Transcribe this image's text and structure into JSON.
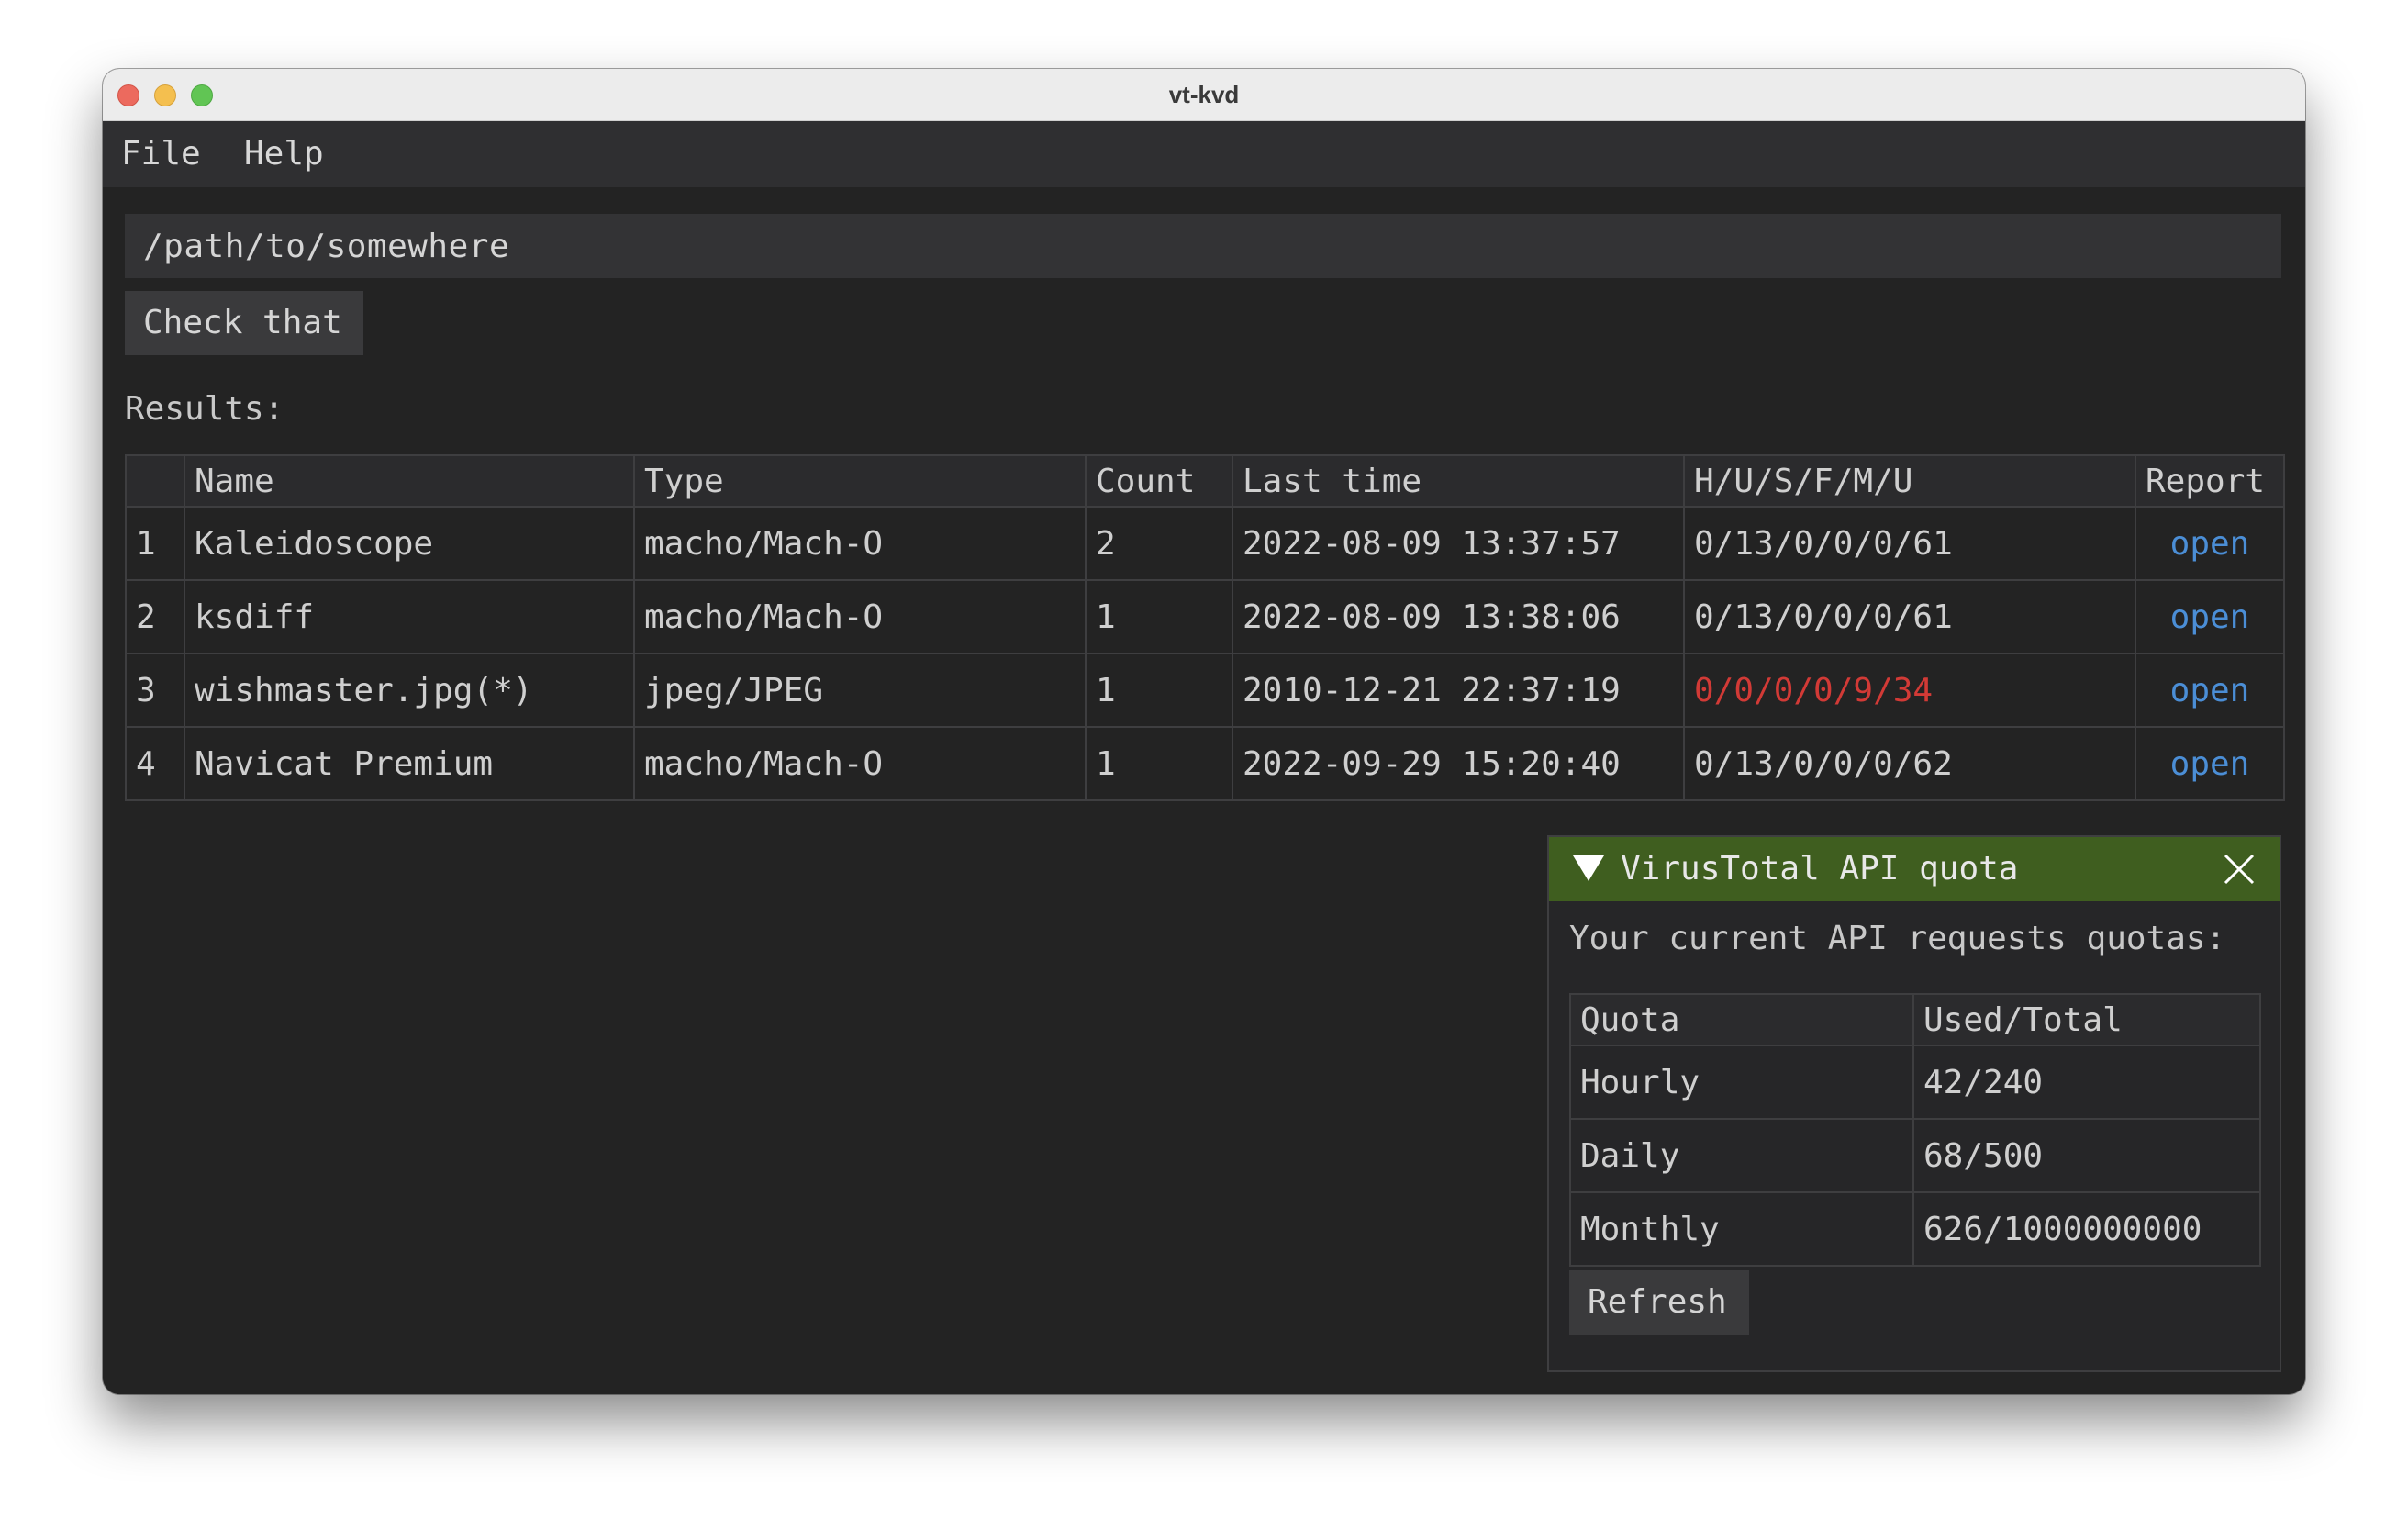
{
  "window": {
    "title": "vt-kvd"
  },
  "menu": {
    "file": "File",
    "help": "Help"
  },
  "path_input": {
    "value": "/path/to/somewhere"
  },
  "check_button": {
    "label": "Check that"
  },
  "results": {
    "label": "Results:",
    "columns": [
      "",
      "Name",
      "Type",
      "Count",
      "Last time",
      "H/U/S/F/M/U",
      "Report"
    ],
    "rows": [
      {
        "index": "1",
        "name": "Kaleidoscope",
        "type": "macho/Mach-O",
        "count": "2",
        "last_time": "2022-08-09 13:37:57",
        "stats": "0/13/0/0/0/61",
        "report": "open"
      },
      {
        "index": "2",
        "name": "ksdiff",
        "type": "macho/Mach-O",
        "count": "1",
        "last_time": "2022-08-09 13:38:06",
        "stats": "0/13/0/0/0/61",
        "report": "open"
      },
      {
        "index": "3",
        "name": "wishmaster.jpg(*)",
        "type": "jpeg/JPEG",
        "count": "1",
        "last_time": "2010-12-21 22:37:19",
        "stats": "0/0/0/0/9/34",
        "report": "open"
      },
      {
        "index": "4",
        "name": "Navicat Premium",
        "type": "macho/Mach-O",
        "count": "1",
        "last_time": "2022-09-29 15:20:40",
        "stats": "0/13/0/0/0/62",
        "report": "open"
      }
    ]
  },
  "quota_panel": {
    "title": "VirusTotal API quota",
    "description": "Your current API requests quotas:",
    "columns": [
      "Quota",
      "Used/Total"
    ],
    "rows": [
      {
        "quota": "Hourly",
        "value": "42/240"
      },
      {
        "quota": "Daily",
        "value": "68/500"
      },
      {
        "quota": "Monthly",
        "value": "626/1000000000"
      }
    ],
    "refresh_label": "Refresh"
  },
  "colors": {
    "window_bg": "#232323",
    "link": "#4b8ed6",
    "alert": "#d23a36",
    "panel_header": "#3f5e1f"
  }
}
